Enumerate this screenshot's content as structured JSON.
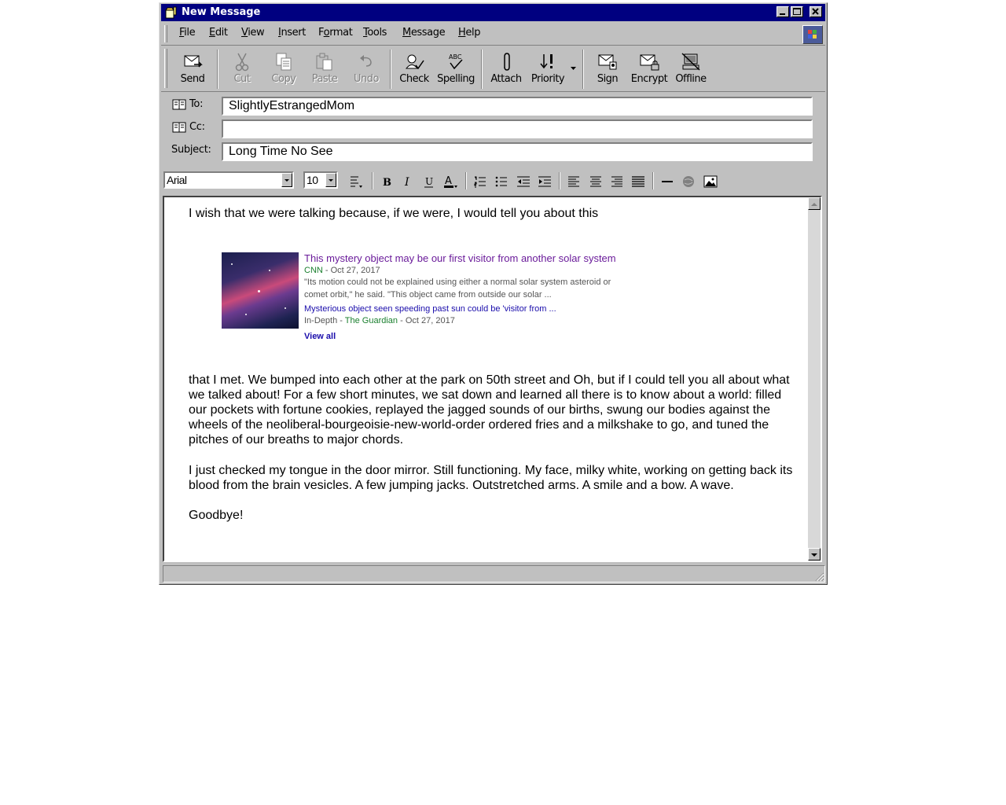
{
  "window": {
    "title": "New Message"
  },
  "menu": [
    {
      "label": "File",
      "key": "F",
      "rest": "ile"
    },
    {
      "label": "Edit",
      "key": "E",
      "rest": "dit"
    },
    {
      "label": "View",
      "key": "V",
      "rest": "iew"
    },
    {
      "label": "Insert",
      "key": "I",
      "rest": "nsert"
    },
    {
      "label": "Format",
      "key": "o",
      "pre": "F",
      "rest": "rmat"
    },
    {
      "label": "Tools",
      "key": "T",
      "rest": "ools"
    },
    {
      "label": "Message",
      "key": "M",
      "rest": "essage"
    },
    {
      "label": "Help",
      "key": "H",
      "rest": "elp"
    }
  ],
  "toolbar": {
    "send": "Send",
    "cut": "Cut",
    "copy": "Copy",
    "paste": "Paste",
    "undo": "Undo",
    "check": "Check",
    "spelling": "Spelling",
    "attach": "Attach",
    "priority": "Priority",
    "sign": "Sign",
    "encrypt": "Encrypt",
    "offline": "Offline"
  },
  "header": {
    "to_label": "To:",
    "to_value": "SlightlyEstrangedMom",
    "cc_label": "Cc:",
    "cc_value": "",
    "subject_label": "Subject:",
    "subject_value": "Long Time No See"
  },
  "format": {
    "font": "Arial",
    "size": "10"
  },
  "body": {
    "line1": "I wish that we were talking because, if we were, I would tell you about this",
    "para2": "that I met. We bumped into each other at the park on 50th street and Oh, but if I could tell you all about what we talked about! For a few short minutes, we sat down and learned all there is to know about a world: filled our pockets with fortune cookies, replayed the jagged sounds of our births, swung our bodies against the wheels of the neoliberal-bourgeoisie-new-world-order ordered fries and a milkshake to go, and tuned the pitches of our breaths to major chords.",
    "para3": "I just checked my tongue in the door mirror. Still functioning. My face, milky white, working on getting back its blood from the brain vesicles. A few jumping jacks. Outstretched arms. A smile and a bow. A wave.",
    "para4": "Goodbye!"
  },
  "embed": {
    "title": "This mystery object may be our first visitor from another solar system",
    "source": "CNN",
    "date": " - Oct 27, 2017",
    "snippet1": "\"Its motion could not be explained using either a normal solar system asteroid or",
    "snippet2": "comet orbit,\" he said. \"This object came from outside our solar ...",
    "link2": "Mysterious object seen speeding past sun could be 'visitor from ...",
    "meta2_prefix": "In-Depth - ",
    "meta2_source": "The Guardian",
    "meta2_date": " - Oct 27, 2017",
    "view_all": "View all"
  }
}
